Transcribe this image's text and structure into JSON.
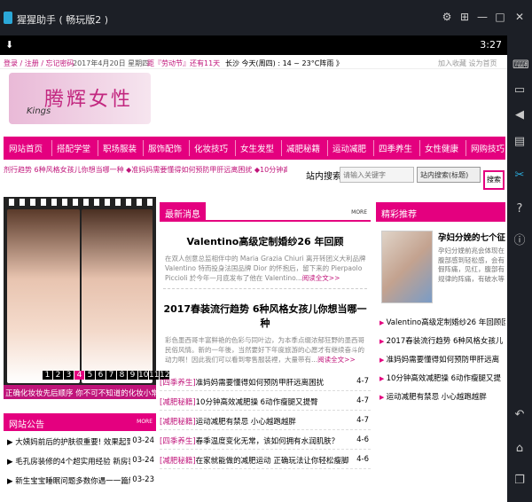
{
  "window": {
    "title": "猩猩助手 ( 畅玩版2 )"
  },
  "status_bar": {
    "time": "3:27"
  },
  "top": {
    "login": "登录 / 注册 / 忘记密码",
    "date": "2017年4月20日 星期四",
    "holiday": "距『劳动节』还有11天",
    "weather": "长沙  今天(周四) : 14 ~ 23°C阵雨 》",
    "links": "加入收藏  设为首页"
  },
  "logo": {
    "text": "腾辉女性",
    "signature": "Kings"
  },
  "nav": [
    "网站首页",
    "搭配学堂",
    "职场服装",
    "服饰配饰",
    "化妆技巧",
    "女生发型",
    "减肥秘籍",
    "运动减肥",
    "四季养生",
    "女性健康",
    "网购技巧"
  ],
  "ticker": "剂行趋势 6种风格女孩儿你想当哪一种    ◆准妈妈需要懂得如何预防甲肝远离困扰    ◆10分钟高效",
  "search": {
    "label": "站内搜索",
    "placeholder": "请输入关键字",
    "select": "站内搜索(标题)",
    "button": "搜索"
  },
  "slideshow": {
    "pages": [
      "1",
      "2",
      "3",
      "4",
      "5",
      "6",
      "7",
      "8",
      "9",
      "10",
      "11",
      "12"
    ],
    "active_page": "4",
    "caption": "正确化妆妆先后顺序 你不可不知道的化妆小常"
  },
  "notice": {
    "title": "网站公告",
    "more": "MORE",
    "items": [
      {
        "text": "大姨妈前后的护肤很重要! 效果起到",
        "date": "03-24"
      },
      {
        "text": "毛孔房装修的4个超实用经验 新房装",
        "date": "03-24"
      },
      {
        "text": "新生宝宝睡眠问题多数你遇一一篇解",
        "date": "03-23"
      }
    ]
  },
  "news": {
    "title": "最新消息",
    "more": "MORE",
    "featured": [
      {
        "headline": "Valentino高级定制婚纱26 年回顾",
        "summary": "在双人创意总监相伴中的 Maria Grazia Chiuri 离开转团义大利品牌 Valentino 特而投身法国品牌 Dior 的怀抱后，留下来的 Pierpaolo Piccioli 於今年一月底发布了他在 Valentino...",
        "more": "阅读全文>>"
      },
      {
        "headline": "2017春装流行趋势 6种风格女孩儿你想当哪一种",
        "summary": "彩色墨西哥丰富鲜艳的色彩与同叶边，为本季点缀浓郁狂野的墨西哥民俗风情。新的一年後，当然要好下年度旅游的心愿才有继续奋斗的动力啊！因此我们可以看到零售服装裡，大量带有...",
        "more": "阅读全文>>"
      }
    ],
    "list": [
      {
        "category": "[四季养生]",
        "text": "准妈妈需要懂得如何预防甲肝远离困扰",
        "date": "4-7"
      },
      {
        "category": "[减肥秘籍]",
        "text": "10分钟高效减肥操 6动作瘦腿又提臀",
        "date": "4-7"
      },
      {
        "category": "[减肥秘籍]",
        "text": "运动减肥有禁忌 小心越跑越胖",
        "date": "4-7"
      },
      {
        "category": "[四季养生]",
        "text": "春季温度变化无常，该如何拥有水润肌肤？",
        "date": "4-6"
      },
      {
        "category": "[减肥秘籍]",
        "text": "在家就能做的减肥运动 正确玩法让你轻松瘦脚",
        "date": "4-6"
      }
    ]
  },
  "recommend": {
    "title": "精彩推荐",
    "feature_title": "孕妇分娩的七个征",
    "feature_desc": "孕妇分娩前兆会体现在腹部感到轻松感，会有假阵痛，见红，腹部有规律的阵痛，有破水等",
    "items": [
      "Valentino高级定制婚纱26 年回顾回",
      "2017春装流行趋势 6种风格女孩儿",
      "准妈妈需要懂得如何预防甲肝远离",
      "10分钟高效减肥操 6动作瘦腿又提",
      "运动减肥有禁忌 小心越跑越胖"
    ]
  }
}
